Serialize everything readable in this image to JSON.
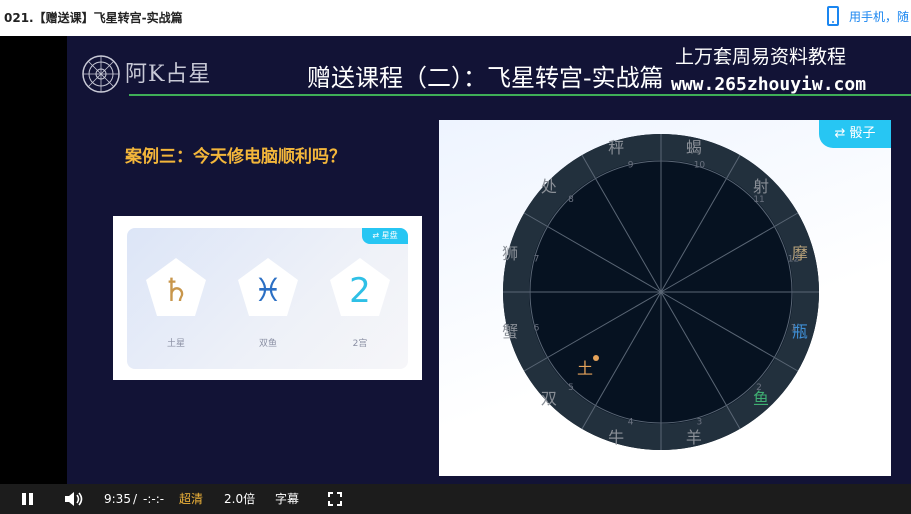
{
  "page": {
    "title": "021.【赠送课】飞星转宫-实战篇"
  },
  "mobile_link": {
    "label": "用手机，随",
    "icon": "phone-icon",
    "color": "#1a86f0"
  },
  "slide": {
    "logo_text": "阿K占星",
    "title": "赠送课程（二）：飞星转宫-实战篇",
    "watermark_line1": "上万套周易资料教程",
    "watermark_line2": "www.265zhouyiw.com",
    "case_title": "案例三：今天修电脑顺利吗？",
    "accent_color": "#f3b63a"
  },
  "card": {
    "tag": "⇄ 星盘",
    "items": [
      {
        "glyph": "♄",
        "label": "土星",
        "color": "#c8964b"
      },
      {
        "glyph": "♓",
        "label": "双鱼",
        "color": "#2b6fc4"
      },
      {
        "glyph": "2",
        "label": "2宫",
        "color": "#2fc0e6"
      }
    ]
  },
  "chart": {
    "tag": "⇄ 骰子",
    "signs": [
      {
        "sign": "蝎",
        "house": "10"
      },
      {
        "sign": "秤",
        "house": "9"
      },
      {
        "sign": "处",
        "house": "8"
      },
      {
        "sign": "狮",
        "house": "7"
      },
      {
        "sign": "蟹",
        "house": "6"
      },
      {
        "sign": "双",
        "house": "5"
      },
      {
        "sign": "牛",
        "house": "4"
      },
      {
        "sign": "羊",
        "house": "3"
      },
      {
        "sign": "鱼",
        "house": "2"
      },
      {
        "sign": "瓶",
        "house": "1"
      },
      {
        "sign": "摩",
        "house": "12"
      },
      {
        "sign": "射",
        "house": "11"
      }
    ],
    "planet": {
      "glyph": "土",
      "color": "#e5a35a"
    }
  },
  "controls": {
    "current_time": "9:35",
    "separator": "/",
    "duration": "-:-:-",
    "quality": "超清",
    "speed": "2.0倍",
    "subtitle": "字幕"
  }
}
